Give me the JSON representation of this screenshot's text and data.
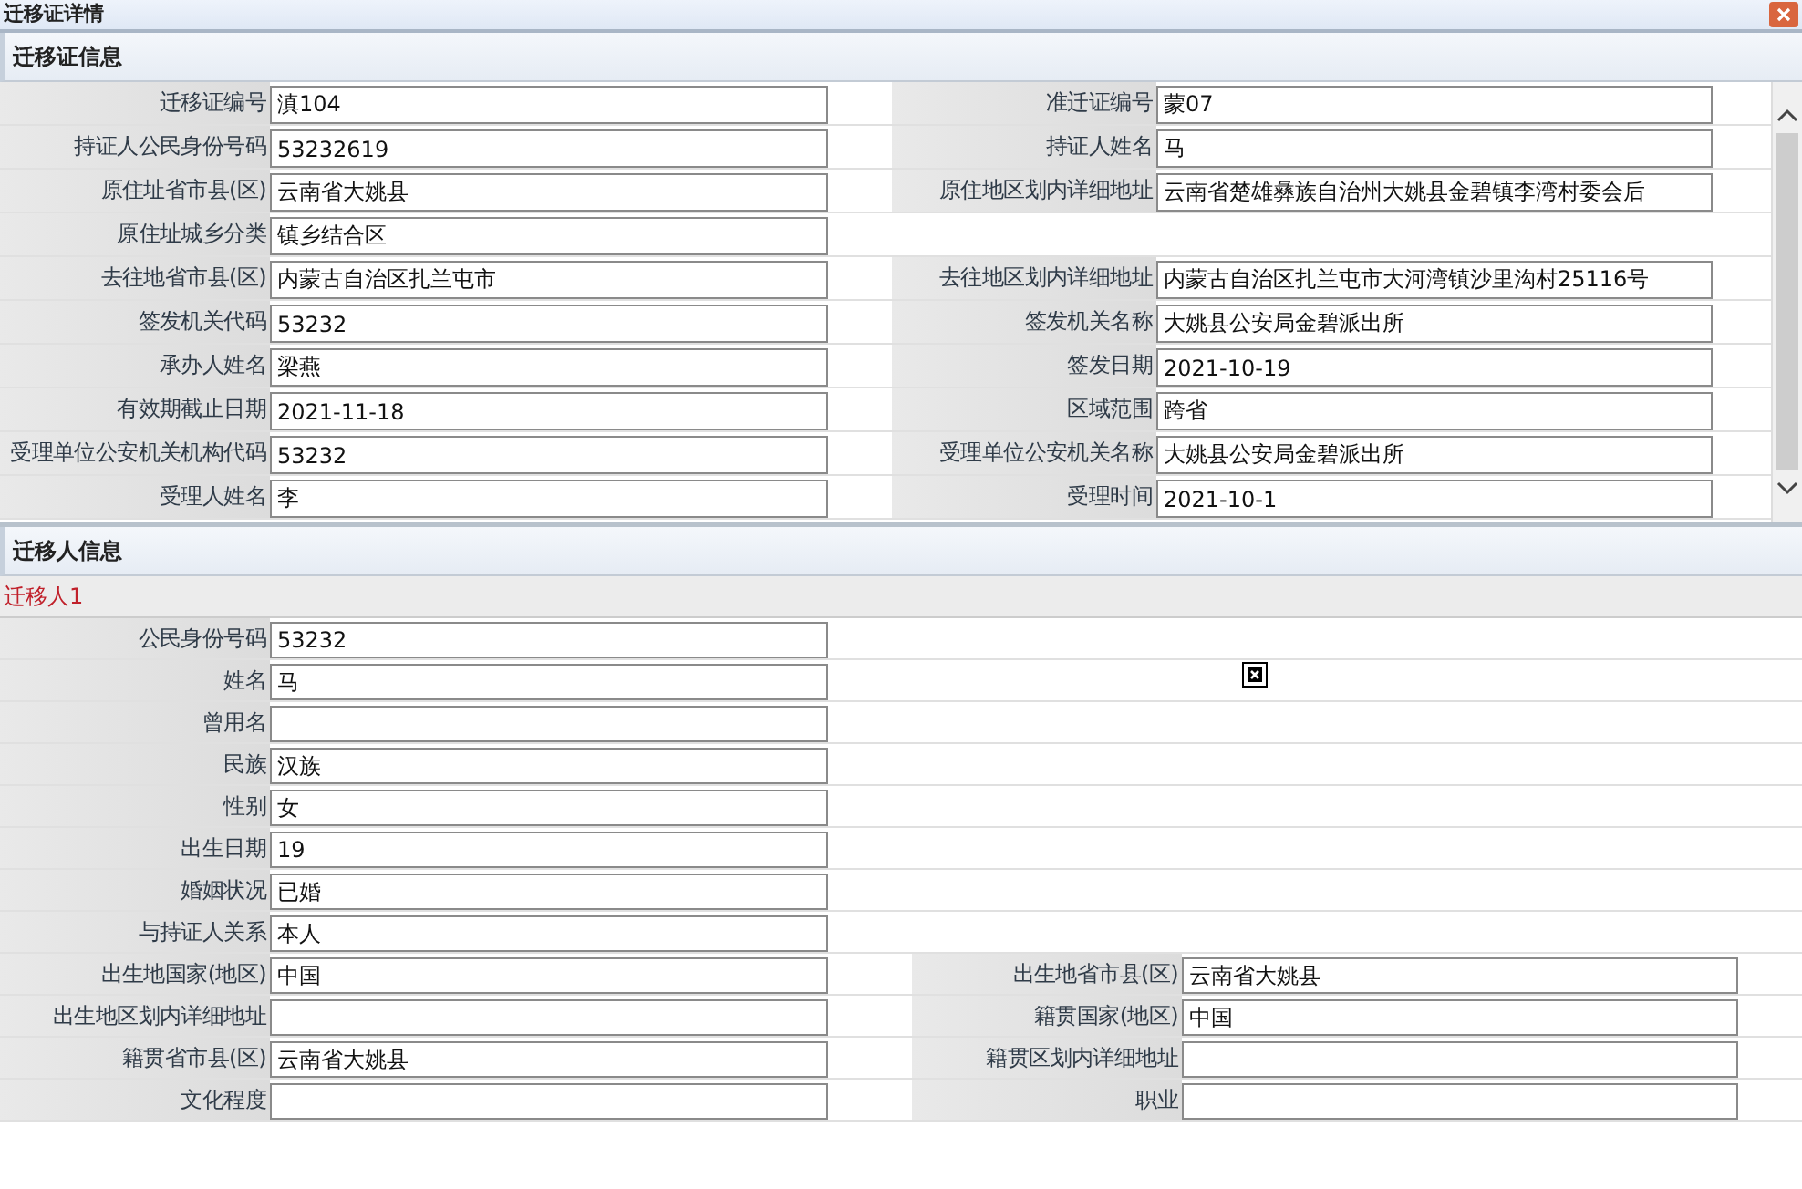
{
  "window": {
    "title": "迁移证详情"
  },
  "certificate": {
    "title": "迁移证信息",
    "rows": [
      {
        "left": {
          "label": "迁移证编号",
          "value": "滇104"
        },
        "right": {
          "label": "准迁证编号",
          "value": "蒙07"
        }
      },
      {
        "left": {
          "label": "持证人公民身份号码",
          "value": "53232619"
        },
        "right": {
          "label": "持证人姓名",
          "value": "马"
        }
      },
      {
        "left": {
          "label": "原住址省市县(区)",
          "value": "云南省大姚县"
        },
        "right": {
          "label": "原住地区划内详细地址",
          "value": "云南省楚雄彝族自治州大姚县金碧镇李湾村委会后"
        }
      },
      {
        "left": {
          "label": "原住址城乡分类",
          "value": "镇乡结合区"
        }
      },
      {
        "left": {
          "label": "去往地省市县(区)",
          "value": "内蒙古自治区扎兰屯市"
        },
        "right": {
          "label": "去往地区划内详细地址",
          "value": "内蒙古自治区扎兰屯市大河湾镇沙里沟村25116号"
        }
      },
      {
        "left": {
          "label": "签发机关代码",
          "value": "53232"
        },
        "right": {
          "label": "签发机关名称",
          "value": "大姚县公安局金碧派出所"
        }
      },
      {
        "left": {
          "label": "承办人姓名",
          "value": "梁燕"
        },
        "right": {
          "label": "签发日期",
          "value": "2021-10-19"
        }
      },
      {
        "left": {
          "label": "有效期截止日期",
          "value": "2021-11-18"
        },
        "right": {
          "label": "区域范围",
          "value": "跨省"
        }
      },
      {
        "left": {
          "label": "受理单位公安机关机构代码",
          "value": "53232"
        },
        "right": {
          "label": "受理单位公安机关名称",
          "value": "大姚县公安局金碧派出所"
        }
      },
      {
        "left": {
          "label": "受理人姓名",
          "value": "李"
        },
        "right": {
          "label": "受理时间",
          "value": "2021-10-1"
        }
      }
    ]
  },
  "migrants": {
    "title": "迁移人信息",
    "person": "迁移人1",
    "rows": [
      {
        "left": {
          "label": "公民身份号码",
          "value": "53232"
        }
      },
      {
        "left": {
          "label": "姓名",
          "value": "马"
        }
      },
      {
        "left": {
          "label": "曾用名"
        }
      },
      {
        "left": {
          "label": "民族",
          "value": "汉族"
        }
      },
      {
        "left": {
          "label": "性别",
          "value": "女"
        }
      },
      {
        "left": {
          "label": "出生日期",
          "value": "19"
        }
      },
      {
        "left": {
          "label": "婚姻状况",
          "value": "已婚"
        }
      },
      {
        "left": {
          "label": "与持证人关系",
          "value": "本人"
        }
      },
      {
        "left": {
          "label": "出生地国家(地区)",
          "value": "中国"
        },
        "right": {
          "label": "出生地省市县(区)",
          "value": "云南省大姚县"
        }
      },
      {
        "left": {
          "label": "出生地区划内详细地址"
        },
        "right": {
          "label": "籍贯国家(地区)",
          "value": "中国"
        }
      },
      {
        "left": {
          "label": "籍贯省市县(区)",
          "value": "云南省大姚县"
        },
        "right": {
          "label": "籍贯区划内详细地址"
        }
      },
      {
        "left": {
          "label": "文化程度"
        },
        "right": {
          "label": "职业"
        }
      }
    ]
  }
}
